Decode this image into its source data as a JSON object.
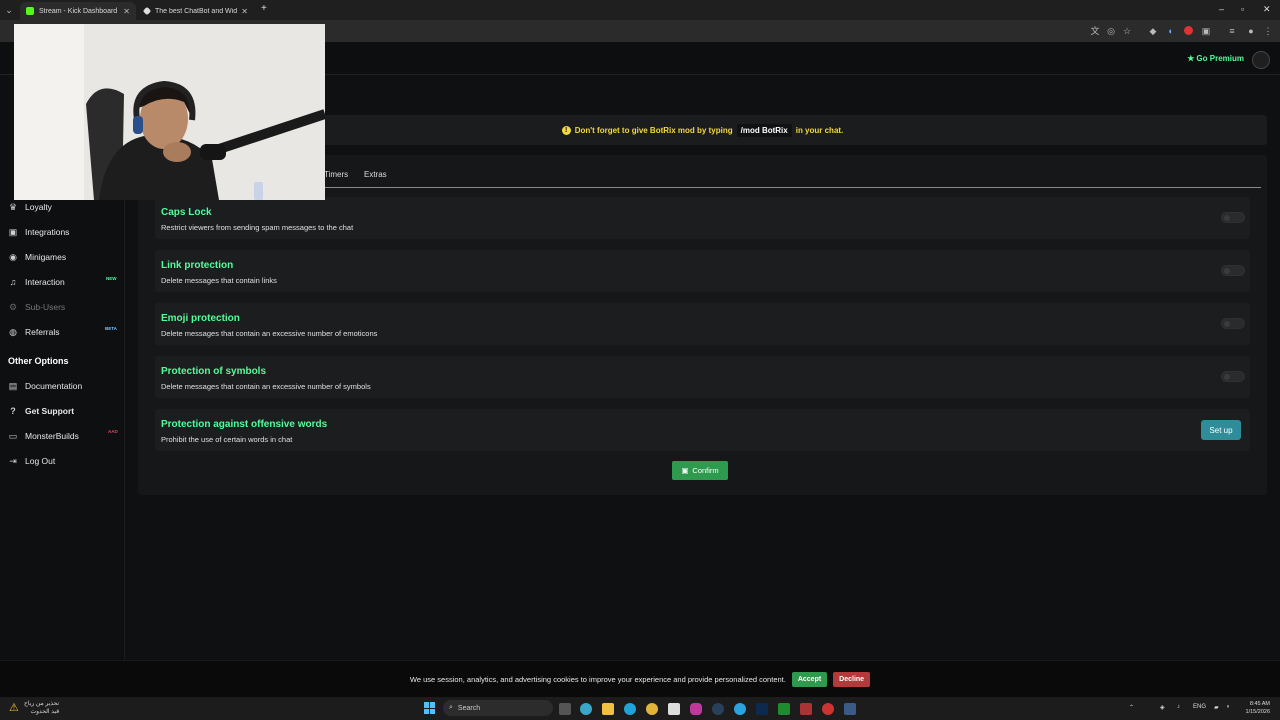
{
  "browser": {
    "tabs": [
      {
        "title": "Stream - Kick Dashboard",
        "active": true
      },
      {
        "title": "The best ChatBot and Widgets",
        "active": false
      }
    ],
    "new_tab": "+",
    "window_controls": {
      "minimize": "–",
      "maximize": "▫",
      "close": "✕"
    }
  },
  "header": {
    "premium_label": "Go Premium"
  },
  "sidebar": {
    "items": [
      {
        "label": "Loyalty",
        "icon": "trophy-icon"
      },
      {
        "label": "Integrations",
        "icon": "integrations-icon"
      },
      {
        "label": "Minigames",
        "icon": "gamepad-icon"
      },
      {
        "label": "Interaction",
        "icon": "music-icon",
        "badge": "NEW"
      },
      {
        "label": "Sub-Users",
        "icon": "user-gear-icon"
      },
      {
        "label": "Referrals",
        "icon": "users-icon",
        "badge": "BETA"
      }
    ],
    "other_heading": "Other Options",
    "other_items": [
      {
        "label": "Documentation",
        "icon": "book-icon"
      },
      {
        "label": "Get Support",
        "icon": "question-icon"
      },
      {
        "label": "MonsterBuilds",
        "icon": "monitor-icon",
        "badge": "AAD"
      },
      {
        "label": "Log Out",
        "icon": "logout-icon"
      }
    ]
  },
  "notice": {
    "before": "Don't forget to give BotRix mod by typing",
    "command": "/mod BotRix",
    "after": "in your chat."
  },
  "tabs": [
    "Timers",
    "Extras"
  ],
  "protections": [
    {
      "title": "Caps Lock",
      "desc": "Restrict viewers from sending spam messages to the chat",
      "enabled": false
    },
    {
      "title": "Link protection",
      "desc": "Delete messages that contain links",
      "enabled": false
    },
    {
      "title": "Emoji protection",
      "desc": "Delete messages that contain an excessive number of emoticons",
      "enabled": false
    },
    {
      "title": "Protection of symbols",
      "desc": "Delete messages that contain an excessive number of symbols",
      "enabled": false
    },
    {
      "title": "Protection against offensive words",
      "desc": "Prohibit the use of certain words in chat",
      "action": "Set up"
    }
  ],
  "confirm_label": "Confirm",
  "cookie": {
    "text": "We use session, analytics, and advertising cookies to improve your experience and provide personalized content.",
    "accept": "Accept",
    "decline": "Decline"
  },
  "taskbar": {
    "weather_line1": "تحذير من رياح",
    "weather_line2": "قيد الحدوث",
    "search_placeholder": "Search",
    "lang": "ENG",
    "time": "8:45 AM",
    "date": "1/15/2026"
  },
  "colors": {
    "accent_green": "#53fc9a",
    "notice_yellow": "#f2d93d",
    "setup_teal": "#2f8d9a",
    "confirm_green": "#2e9a4e",
    "accept_green": "#2e9a4e",
    "decline_red": "#b33a3a"
  }
}
